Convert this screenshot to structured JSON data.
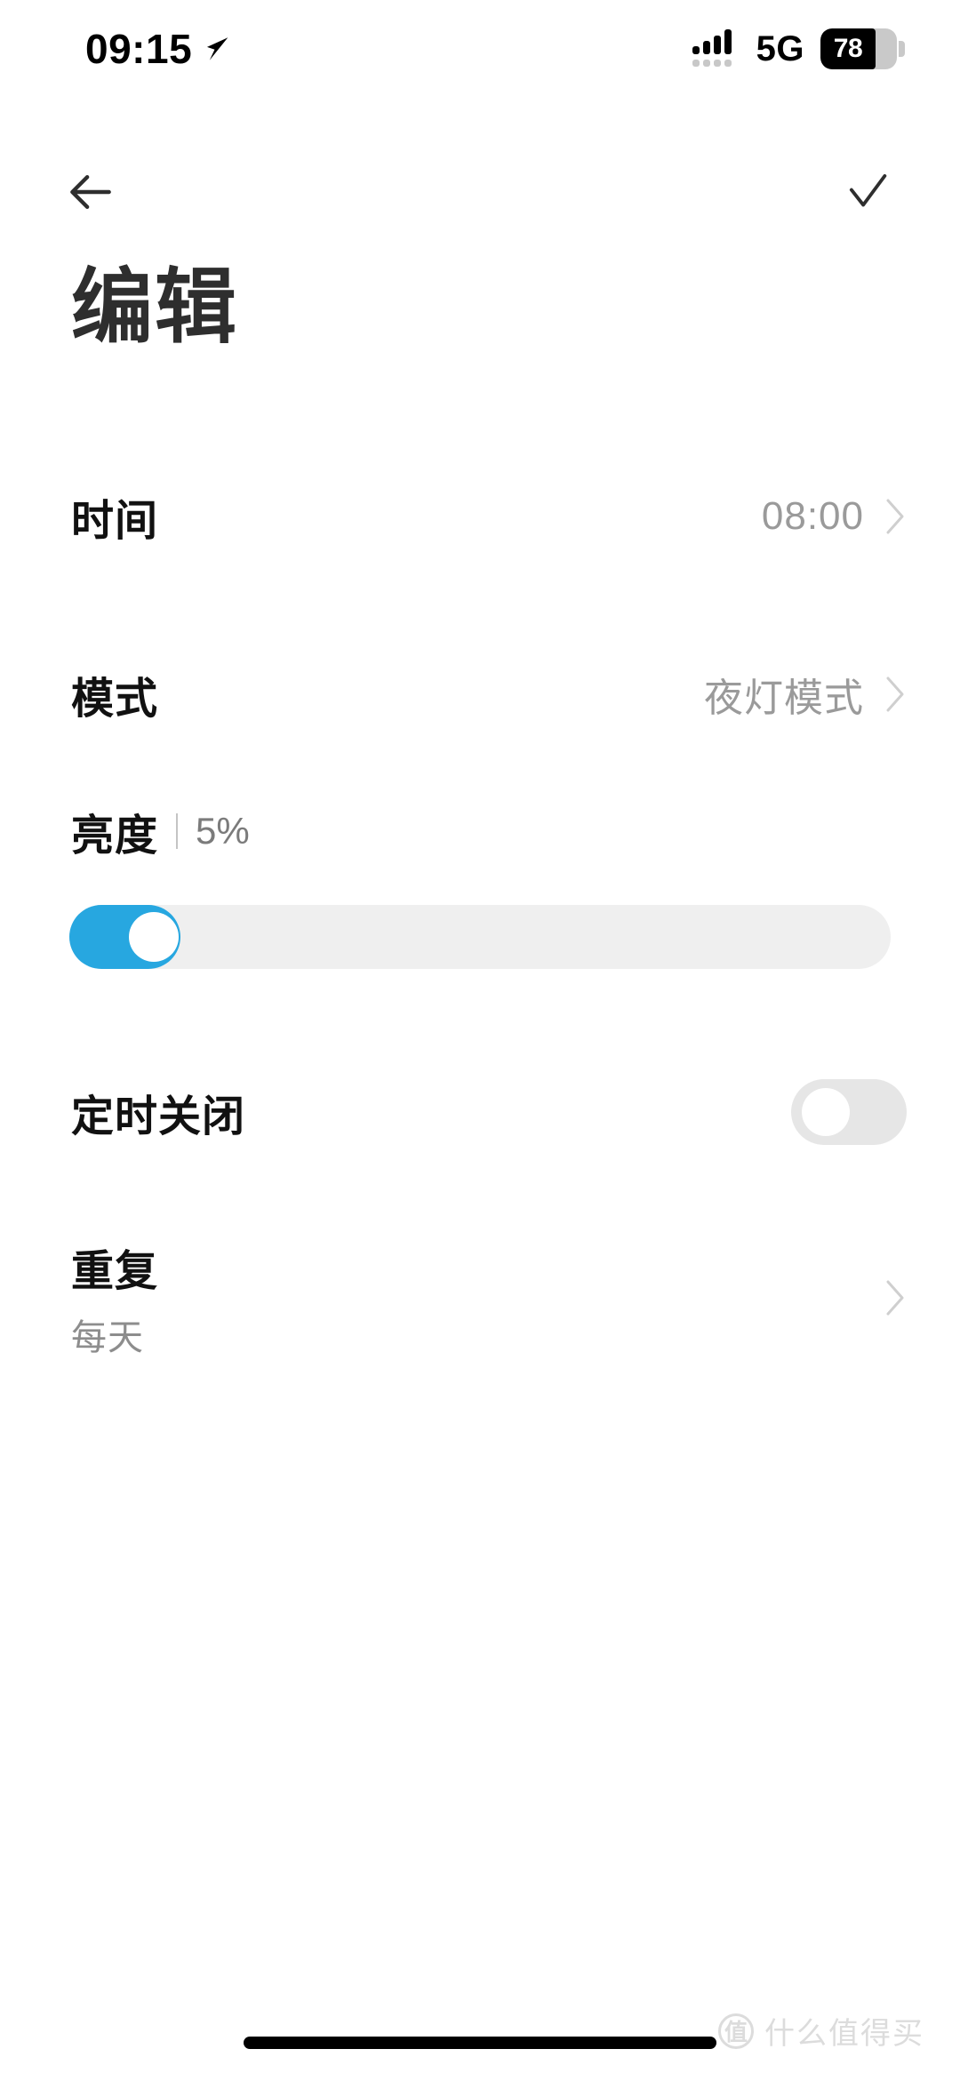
{
  "status_bar": {
    "time": "09:15",
    "location_icon": "location-arrow-icon",
    "signal_icon": "signal-bars-icon",
    "network": "5G",
    "battery_percent": "78"
  },
  "nav": {
    "back_icon": "arrow-left-icon",
    "confirm_icon": "check-icon"
  },
  "header": {
    "title": "编辑"
  },
  "settings": {
    "time_row": {
      "label": "时间",
      "value": "08:00",
      "chevron_icon": "chevron-right-icon"
    },
    "mode_row": {
      "label": "模式",
      "value": "夜灯模式",
      "chevron_icon": "chevron-right-icon"
    },
    "brightness": {
      "label": "亮度",
      "value": "5%",
      "percent": 5
    },
    "timer_off_row": {
      "label": "定时关闭",
      "toggle_state": "off"
    },
    "repeat_row": {
      "label": "重复",
      "sub_label": "每天",
      "chevron_icon": "chevron-right-icon"
    }
  },
  "footer": {
    "watermark_badge": "值",
    "watermark_text": "什么值得买"
  },
  "colors": {
    "accent": "#27a7e0",
    "track": "#efefef",
    "toggle_off": "#e6e6e6",
    "muted_text": "#9a9a9a",
    "title_text": "#2e2e2e"
  }
}
